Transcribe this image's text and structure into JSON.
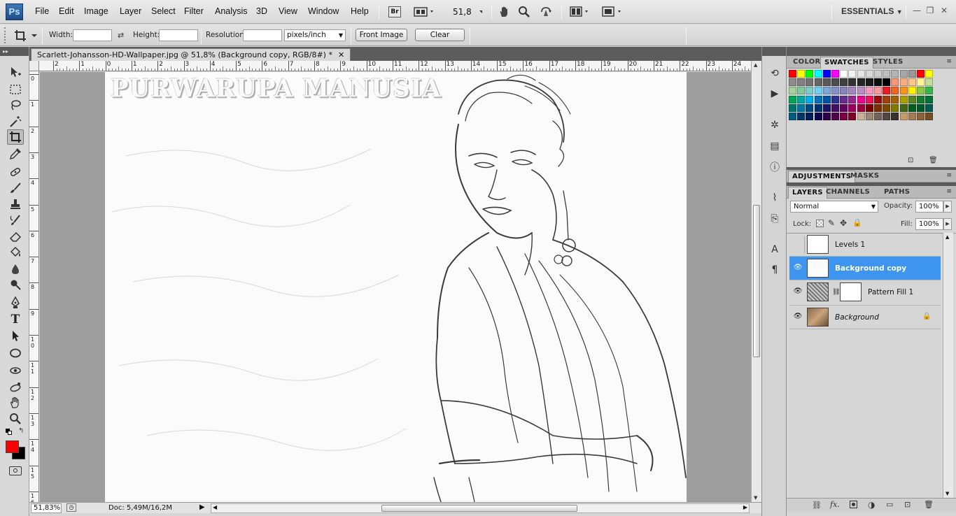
{
  "app": {
    "logo": "Ps"
  },
  "menu": [
    "File",
    "Edit",
    "Image",
    "Layer",
    "Select",
    "Filter",
    "Analysis",
    "3D",
    "View",
    "Window",
    "Help"
  ],
  "menubar": {
    "bridge_label": "Br",
    "zoom_value": "51,8",
    "workspace": "ESSENTIALS"
  },
  "options": {
    "width_label": "Width:",
    "width_value": "",
    "height_label": "Height:",
    "height_value": "",
    "resolution_label": "Resolution:",
    "resolution_value": "",
    "resolution_unit": "pixels/inch",
    "front_image_label": "Front Image",
    "clear_label": "Clear"
  },
  "document": {
    "tab_title": "Scarlett-Johansson-HD-Wallpaper.jpg @ 51,8% (Background copy, RGB/8#) *",
    "close_glyph": "✕",
    "watermark": "PURWARUPA MANUSIA",
    "ruler_top": [
      "2",
      "1",
      "0",
      "1",
      "2",
      "3",
      "4",
      "5",
      "6",
      "7",
      "8",
      "9",
      "10",
      "11",
      "12",
      "13",
      "14",
      "15",
      "16",
      "17",
      "18",
      "19",
      "20",
      "21",
      "22",
      "23",
      "24"
    ],
    "ruler_left": [
      "0",
      "1",
      "2",
      "3",
      "4",
      "5",
      "6",
      "7",
      "8",
      "9",
      "1\n0",
      "1\n1",
      "1\n2",
      "1\n3",
      "1\n4",
      "1\n5",
      "1\n6"
    ]
  },
  "status": {
    "zoom": "51,83%",
    "doc_size": "Doc: 5,49M/16,2M"
  },
  "color_panel": {
    "tabs": [
      "COLOR",
      "SWATCHES",
      "STYLES"
    ],
    "active_tab": "SWATCHES",
    "swatch_rows": [
      [
        "#ff0000",
        "#ffff00",
        "#00ff00",
        "#00ffff",
        "#0000ff",
        "#ff00ff",
        "#ffffff",
        "#f2f2f2",
        "#e6e6e6",
        "#d9d9d9",
        "#cccccc",
        "#bfbfbf",
        "#b3b3b3",
        "#a6a6a6",
        "#999999",
        "#ff0000",
        "#ffff00"
      ],
      [
        "#8c8c8c",
        "#808080",
        "#737373",
        "#666666",
        "#595959",
        "#4d4d4d",
        "#404040",
        "#333333",
        "#262626",
        "#1a1a1a",
        "#0d0d0d",
        "#000000",
        "#f7977a",
        "#fbad82",
        "#fdc68c",
        "#fff79a",
        "#c4df9b"
      ],
      [
        "#a3d39c",
        "#82ca9c",
        "#7accc8",
        "#6dcff6",
        "#7da7d8",
        "#8493ca",
        "#8882be",
        "#a187be",
        "#bc8dbf",
        "#f49ac2",
        "#f6989d",
        "#ed1c24",
        "#f26522",
        "#f7941d",
        "#fff200",
        "#8dc63f",
        "#39b54a"
      ],
      [
        "#00a651",
        "#00a99d",
        "#00aeef",
        "#0072bc",
        "#0054a6",
        "#2e3192",
        "#662d91",
        "#92278f",
        "#ec008c",
        "#ed145b",
        "#9e0b0f",
        "#a0410d",
        "#a36209",
        "#aba000",
        "#598527",
        "#197b30",
        "#007236"
      ],
      [
        "#00746b",
        "#0076a3",
        "#004a80",
        "#003471",
        "#1b1464",
        "#440e62",
        "#630460",
        "#9e005d",
        "#9e0039",
        "#790000",
        "#7b2e00",
        "#7d4900",
        "#827b00",
        "#406618",
        "#005e20",
        "#005826",
        "#005952"
      ],
      [
        "#005b7f",
        "#003663",
        "#002157",
        "#0d004c",
        "#32004b",
        "#4b0049",
        "#7b0046",
        "#7a0026",
        "#c7b299",
        "#998675",
        "#736357",
        "#534741",
        "#37302d",
        "#c69c6d",
        "#a67c52",
        "#8c6239",
        "#754c24"
      ]
    ]
  },
  "adjustments_panel": {
    "tabs": [
      "ADJUSTMENTS",
      "MASKS"
    ]
  },
  "layers_panel": {
    "tabs": [
      "LAYERS",
      "CHANNELS",
      "PATHS"
    ],
    "blend_mode": "Normal",
    "opacity_label": "Opacity:",
    "opacity_value": "100%",
    "lock_label": "Lock:",
    "fill_label": "Fill:",
    "fill_value": "100%",
    "layers": [
      {
        "name": "Levels 1",
        "visible": false,
        "selected": false
      },
      {
        "name": "Background copy",
        "visible": true,
        "selected": true
      },
      {
        "name": "Pattern Fill 1",
        "visible": true,
        "selected": false
      },
      {
        "name": "Background",
        "visible": true,
        "selected": false
      }
    ],
    "footer_icons": [
      "link-icon",
      "fx-icon",
      "mask-icon",
      "adjustment-icon",
      "group-icon",
      "new-layer-icon",
      "trash-icon"
    ]
  },
  "colors": {
    "foreground": "#ff0000",
    "background": "#000000",
    "selection": "#3d95f0"
  }
}
